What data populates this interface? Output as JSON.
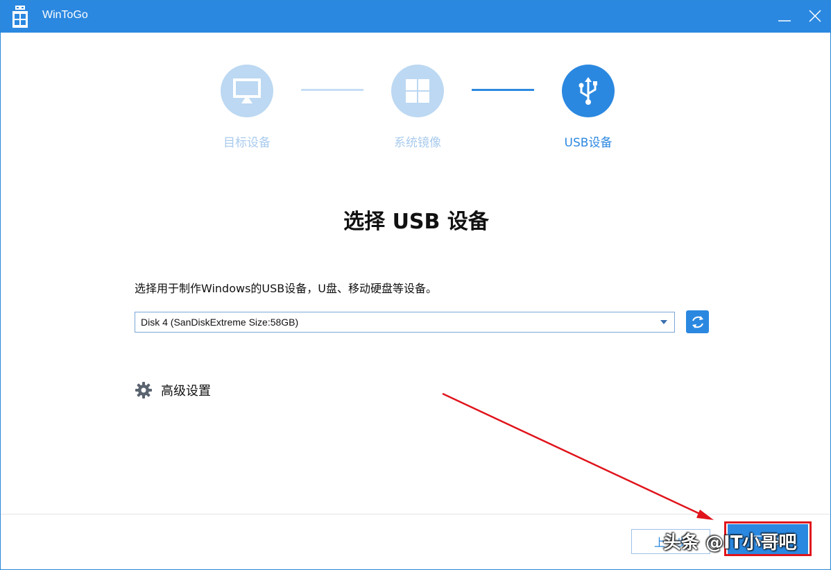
{
  "window": {
    "title": "WinToGo",
    "accent_color": "#2b88e0"
  },
  "steps": [
    {
      "label": "目标设备",
      "icon": "monitor-icon",
      "state": "completed"
    },
    {
      "label": "系统镜像",
      "icon": "windows-logo-icon",
      "state": "completed"
    },
    {
      "label": "USB设备",
      "icon": "usb-icon",
      "state": "active"
    }
  ],
  "main": {
    "title": "选择 USB 设备",
    "description": "选择用于制作Windows的USB设备，U盘、移动硬盘等设备。",
    "device_select": {
      "selected": "Disk 4 (SanDiskExtreme Size:58GB)"
    },
    "refresh_icon": "refresh-icon",
    "advanced_label": "高级设置"
  },
  "footer": {
    "prev_label": "上一步",
    "next_label": "下一步"
  },
  "annotations": {
    "highlight_color": "#e0141c"
  },
  "watermark": "头条 @IT小哥吧"
}
